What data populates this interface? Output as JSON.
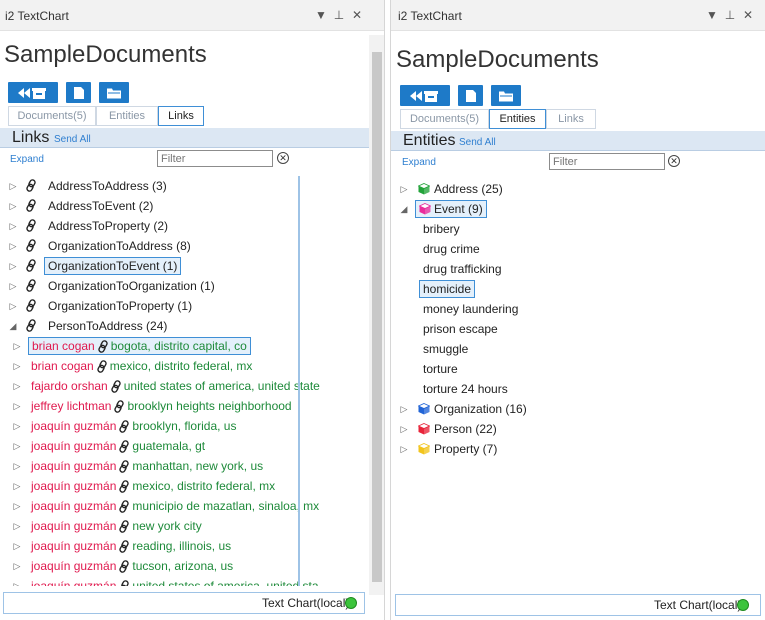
{
  "left": {
    "window_title": "i2 TextChart",
    "controls": {
      "dropdown": "▼",
      "pin": "⊥",
      "close": "✕"
    },
    "doc_title": "SampleDocuments",
    "toolbar_icons": [
      "rewind-archive-icon",
      "document-icon",
      "folder-icon"
    ],
    "tabs": [
      {
        "label": "Documents(5)",
        "active": false
      },
      {
        "label": "Entities",
        "active": false
      },
      {
        "label": "Links",
        "active": true
      }
    ],
    "section_title": "Links",
    "send_all": "Send All",
    "expand": "Expand",
    "filter_placeholder": "Filter",
    "link_groups": [
      {
        "label": "AddressToAddress (3)",
        "expanded": false
      },
      {
        "label": "AddressToEvent (2)",
        "expanded": false
      },
      {
        "label": "AddressToProperty (2)",
        "expanded": false
      },
      {
        "label": "OrganizationToAddress (8)",
        "expanded": false
      },
      {
        "label": "OrganizationToEvent (1)",
        "expanded": false,
        "selected": true
      },
      {
        "label": "OrganizationToOrganization (1)",
        "expanded": false
      },
      {
        "label": "OrganizationToProperty (1)",
        "expanded": false
      },
      {
        "label": "PersonToAddress (24)",
        "expanded": true
      }
    ],
    "person_links": [
      {
        "from": "brian cogan",
        "to": "bogota, distrito capital, co",
        "selected": true
      },
      {
        "from": "brian cogan",
        "to": "mexico, distrito federal, mx"
      },
      {
        "from": "fajardo orshan",
        "to": "united states of america, united state"
      },
      {
        "from": "jeffrey lichtman",
        "to": "brooklyn heights neighborhood"
      },
      {
        "from": "joaquín guzmán",
        "to": "brooklyn, florida, us"
      },
      {
        "from": "joaquín guzmán",
        "to": "guatemala, gt"
      },
      {
        "from": "joaquín guzmán",
        "to": "manhattan, new york, us"
      },
      {
        "from": "joaquín guzmán",
        "to": "mexico, distrito federal, mx"
      },
      {
        "from": "joaquín guzmán",
        "to": "municipio de mazatlan, sinaloa, mx"
      },
      {
        "from": "joaquín guzmán",
        "to": "new york city"
      },
      {
        "from": "joaquín guzmán",
        "to": "reading, illinois, us"
      },
      {
        "from": "joaquín guzmán",
        "to": "tucson, arizona, us"
      },
      {
        "from": "joaquín guzmán",
        "to": "united states of america, united sta"
      }
    ],
    "status": "Text Chart(local)"
  },
  "right": {
    "window_title": "i2 TextChart",
    "controls": {
      "dropdown": "▼",
      "pin": "⊥",
      "close": "✕"
    },
    "doc_title": "SampleDocuments",
    "tabs": [
      {
        "label": "Documents(5)",
        "active": false
      },
      {
        "label": "Entities",
        "active": true
      },
      {
        "label": "Links",
        "active": false
      }
    ],
    "section_title": "Entities",
    "send_all": "Send All",
    "expand": "Expand",
    "filter_placeholder": "Filter",
    "entities": [
      {
        "label": "Address (25)",
        "color": "#22a33a",
        "expanded": false
      },
      {
        "label": "Event (9)",
        "color": "#ea2c9c",
        "expanded": true,
        "selected": true,
        "children": [
          "bribery",
          "drug crime",
          "drug trafficking",
          "homicide",
          "money laundering",
          "prison escape",
          "smuggle",
          "torture",
          "torture 24 hours"
        ],
        "selected_child": "homicide"
      },
      {
        "label": "Organization (16)",
        "color": "#2164d6",
        "expanded": false
      },
      {
        "label": "Person (22)",
        "color": "#e8243a",
        "expanded": false
      },
      {
        "label": "Property (7)",
        "color": "#f2c41c",
        "expanded": false
      }
    ],
    "status": "Text Chart(local)"
  }
}
